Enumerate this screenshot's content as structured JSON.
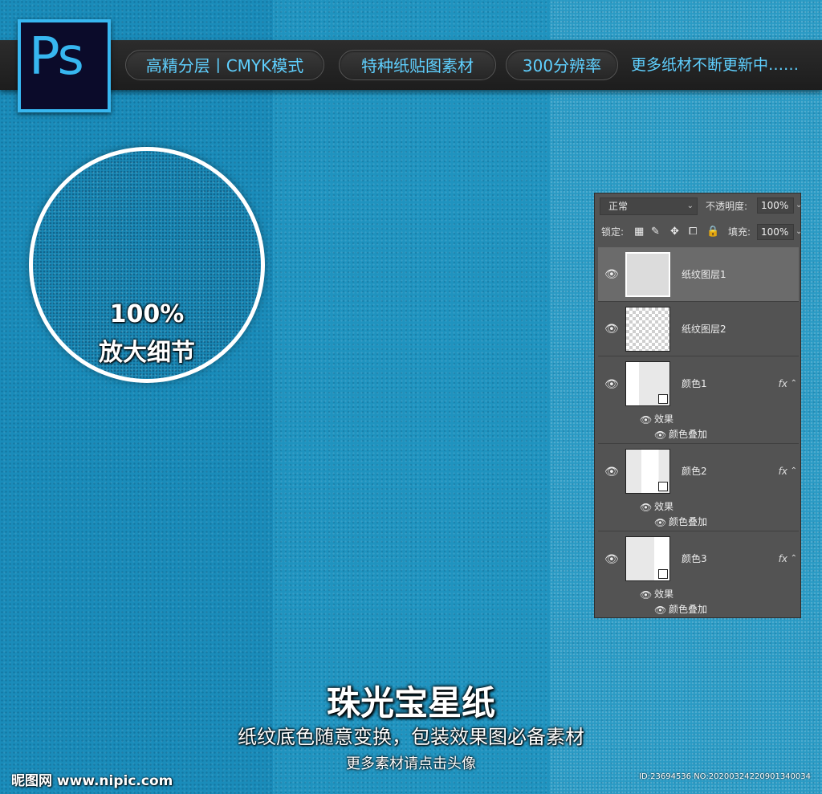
{
  "header": {
    "logo_text": "Ps",
    "pills": [
      "高精分层丨CMYK模式",
      "特种纸贴图素材",
      "300分辨率"
    ],
    "more_text": "更多纸材不断更新中……"
  },
  "zoom": {
    "percent": "100%",
    "label": "放大细节"
  },
  "layers_panel": {
    "blend_mode": "正常",
    "opacity_label": "不透明度:",
    "opacity_value": "100%",
    "lock_label": "锁定:",
    "fill_label": "填充:",
    "fill_value": "100%",
    "layers": [
      {
        "name": "纸纹图层1",
        "selected": true
      },
      {
        "name": "纸纹图层2",
        "selected": false
      },
      {
        "name": "颜色1",
        "fx": "fx",
        "effects_label": "效果",
        "effect": "颜色叠加"
      },
      {
        "name": "颜色2",
        "fx": "fx",
        "effects_label": "效果",
        "effect": "颜色叠加"
      },
      {
        "name": "颜色3",
        "fx": "fx",
        "effects_label": "效果",
        "effect": "颜色叠加"
      }
    ]
  },
  "footer": {
    "title": "珠光宝星纸",
    "subtitle": "纸纹底色随意变换，包装效果图必备素材",
    "subtitle2": "更多素材请点击头像",
    "watermark": "昵图网 www.nipic.com",
    "id_text": "ID:23694536 NO:20200324220901340034"
  },
  "colors": {
    "accent": "#37b7f0",
    "bar": "#262626",
    "paper": "#1b8fbc"
  }
}
